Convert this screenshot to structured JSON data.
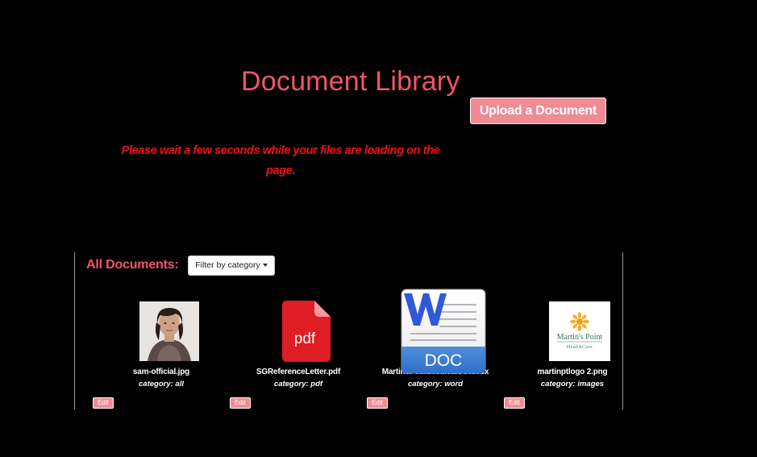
{
  "header": {
    "title": "Document Library",
    "upload_label": "Upload a Document"
  },
  "loading": {
    "message": "Please wait a few seconds while your files are loading on the page."
  },
  "documents": {
    "section_label": "All Documents:",
    "filter_label": "Filter by category",
    "edit_label": "Edit",
    "items": [
      {
        "name": "sam-official.jpg",
        "category": "category: all",
        "icon": "photo-thumbnail"
      },
      {
        "name": "SGReferenceLetter.pdf",
        "category": "category: pdf",
        "icon": "pdf-file-icon",
        "icon_text": "pdf"
      },
      {
        "name": "MartinsPointMedicalSG.docx",
        "category": "category: word",
        "icon": "word-doc-icon",
        "icon_text": "DOC"
      },
      {
        "name": "martinptlogo 2.png",
        "category": "category: images",
        "icon": "martins-point-logo",
        "logo_line1": "Martin's Point",
        "logo_line2": "HealthCare"
      }
    ]
  },
  "colors": {
    "accent": "#f2556b",
    "button": "#f08b94",
    "warning": "#ee1111",
    "background": "#000000"
  }
}
